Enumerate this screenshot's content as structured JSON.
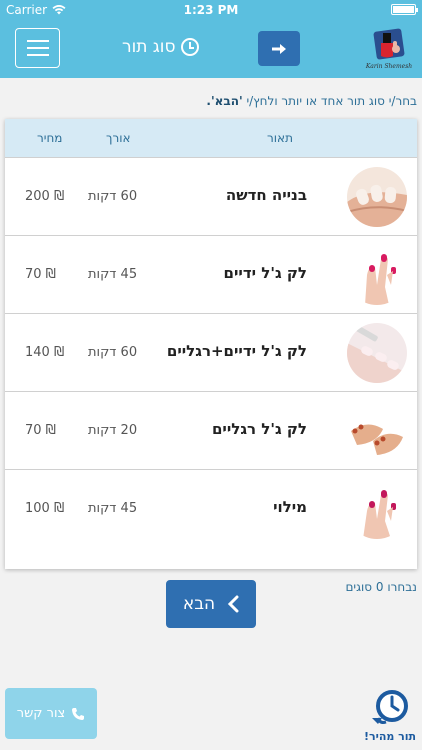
{
  "status_bar": {
    "carrier": "Carrier",
    "time": "1:23 PM"
  },
  "header": {
    "title": "סוג תור",
    "logo_text": "Karin Shemesh",
    "color": "#5bbfdf"
  },
  "instruction": {
    "text": "בחר/י סוג תור אחד או יותר ולחץ/י ",
    "emphasis": "'הבא'."
  },
  "table": {
    "headers": {
      "description": "תאור",
      "length": "אורך",
      "price": "מחיר"
    },
    "rows": [
      {
        "name": "בנייה חדשה",
        "duration": "60 דקות",
        "price": "200 ₪",
        "image": "nails-new-set"
      },
      {
        "name": "לק ג'ל ידיים",
        "duration": "45 דקות",
        "price": "70 ₪",
        "image": "gel-hands"
      },
      {
        "name": "לק ג'ל ידיים+רגליים",
        "duration": "60 דקות",
        "price": "140 ₪",
        "image": "gel-hands-feet"
      },
      {
        "name": "לק ג'ל רגליים",
        "duration": "20 דקות",
        "price": "70 ₪",
        "image": "gel-feet"
      },
      {
        "name": "מילוי",
        "duration": "45 דקות",
        "price": "100 ₪",
        "image": "fill"
      }
    ]
  },
  "selected_count": "נבחרו 0 סוגים",
  "next_button": {
    "label": "הבא"
  },
  "contact_button": {
    "label": "צור קשר"
  },
  "quick_book": {
    "label": "תור מהיר!"
  },
  "colors": {
    "primary_dark": "#2f6fb1",
    "primary_light": "#5bbfdf",
    "contact": "#8fd4ea"
  }
}
